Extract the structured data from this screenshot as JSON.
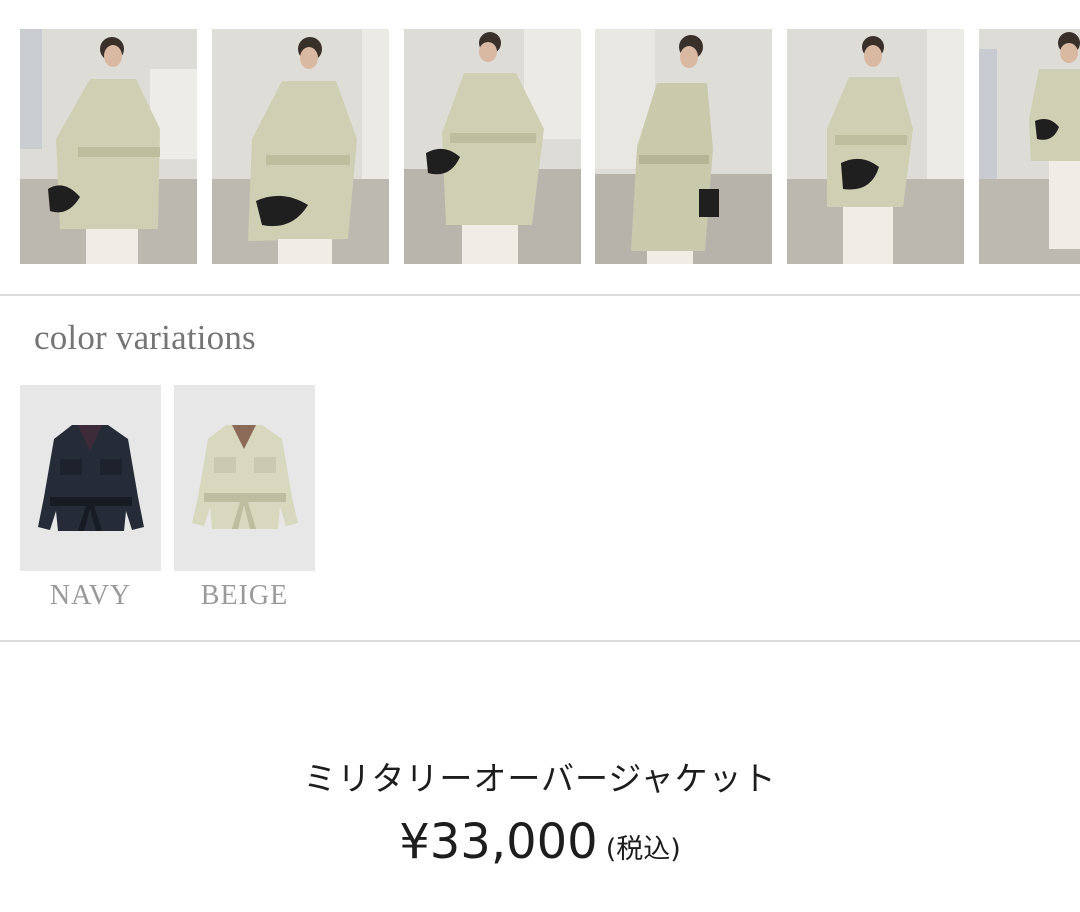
{
  "gallery": {
    "thumbnails": [
      {
        "icon": "model-photo-front"
      },
      {
        "icon": "model-photo-hand-raised"
      },
      {
        "icon": "model-photo-looking-down"
      },
      {
        "icon": "model-photo-side"
      },
      {
        "icon": "model-photo-walking"
      },
      {
        "icon": "model-photo-partial"
      }
    ]
  },
  "color_variations": {
    "title": "color variations",
    "items": [
      {
        "label": "NAVY",
        "jacket_color": "#252b37",
        "shade": "#161b24"
      },
      {
        "label": "BEIGE",
        "jacket_color": "#d8d8bf",
        "shade": "#bdbd9f"
      }
    ]
  },
  "product": {
    "name": "ミリタリーオーバージャケット",
    "price": "¥33,000",
    "tax_note": "(税込)"
  },
  "colors": {
    "jacket_beige": "#cfcfb3",
    "divider": "#dcdcdc",
    "title_gray": "#757575",
    "label_gray": "#9a9a9a"
  }
}
